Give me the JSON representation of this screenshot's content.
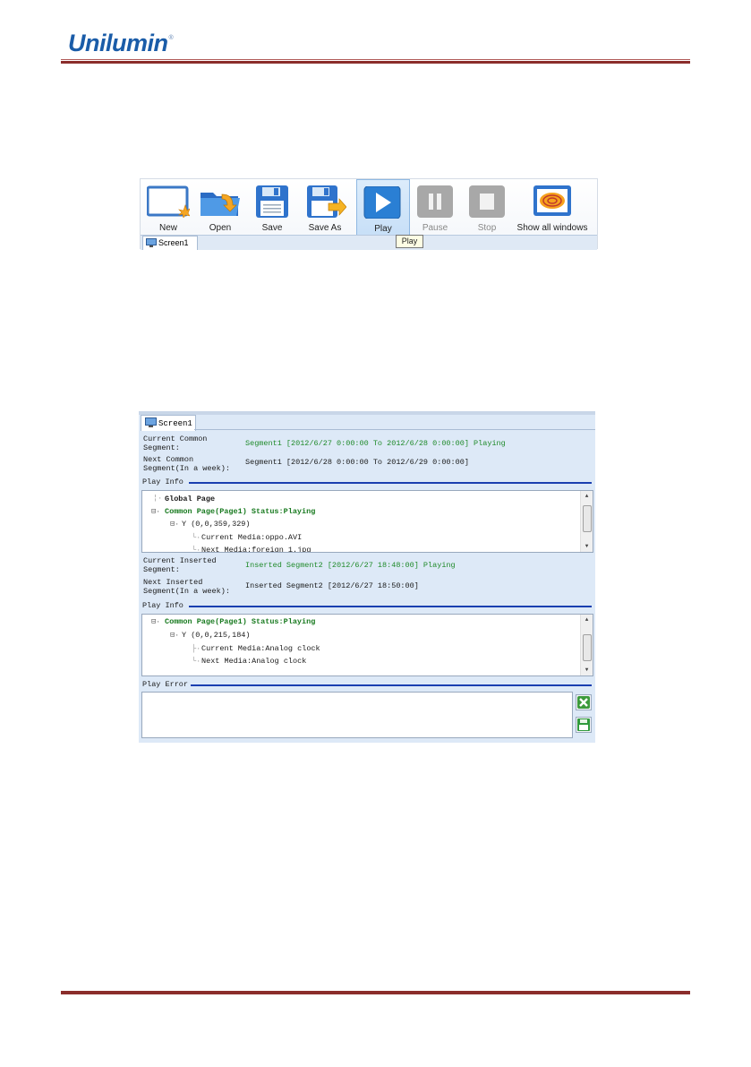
{
  "header": {
    "logo_text": "Unilumin",
    "registered_mark": "®"
  },
  "toolbar": {
    "buttons": [
      {
        "label": "New",
        "icon": "new-icon"
      },
      {
        "label": "Open",
        "icon": "open-folder-icon"
      },
      {
        "label": "Save",
        "icon": "save-icon"
      },
      {
        "label": "Save As",
        "icon": "save-as-icon"
      },
      {
        "label": "Play",
        "icon": "play-icon"
      },
      {
        "label": "Pause",
        "icon": "pause-icon"
      },
      {
        "label": "Stop",
        "icon": "stop-icon"
      },
      {
        "label": "Show all windows",
        "icon": "show-windows-icon"
      }
    ],
    "tab": "Screen1",
    "tooltip": "Play"
  },
  "panel": {
    "tab": "Screen1",
    "current_common_segment_label": "Current Common Segment:",
    "current_common_segment_value": "Segment1 [2012/6/27 0:00:00 To 2012/6/28 0:00:00] Playing",
    "next_common_segment_label": "Next Common Segment(In a week):",
    "next_common_segment_value": "Segment1 [2012/6/28 0:00:00 To 2012/6/29 0:00:00]",
    "play_info_label": "Play Info",
    "tree1": [
      "Global Page",
      "Common Page(Page1) Status:Playing",
      "Y (0,0,359,329)",
      "Current Media:oppo.AVI",
      "Next Media:foreign 1.jpg"
    ],
    "current_inserted_label": "Current Inserted Segment:",
    "current_inserted_value": "Inserted Segment2 [2012/6/27 18:48:00] Playing",
    "next_inserted_label": "Next Inserted Segment(In a week):",
    "next_inserted_value": "Inserted Segment2 [2012/6/27 18:50:00]",
    "play_info_label2": "Play Info",
    "tree2": [
      "Common Page(Page1) Status:Playing",
      "Y (0,0,215,184)",
      "Current Media:Analog clock",
      "Next Media:Analog clock"
    ],
    "play_error_label": "Play Error"
  },
  "colors": {
    "brand": "#1a5ca8",
    "rule": "#8b2d2b",
    "panel_bg": "#dde9f7",
    "status_green": "#1f8a2a"
  }
}
